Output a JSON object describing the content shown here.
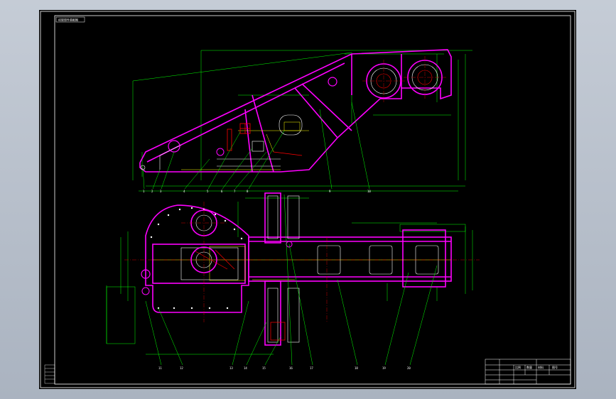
{
  "drawing": {
    "title_tag": "机架部件装配图",
    "side_view_callouts": [
      "1",
      "2",
      "3",
      "4",
      "5",
      "6",
      "7",
      "8",
      "9",
      "10"
    ],
    "plan_view_callouts": [
      "11",
      "12",
      "13",
      "14",
      "15",
      "16",
      "17",
      "18",
      "19",
      "20"
    ],
    "title_block_cells": [
      "比例",
      "数量",
      "材料",
      "图号"
    ],
    "colors": {
      "background": "#000000",
      "frame": "#ffffff",
      "outline": "#ff00ff",
      "dimension": "#00ff00",
      "centerline": "#ff0000",
      "hidden": "#ffff00",
      "text": "#ffffff"
    }
  }
}
